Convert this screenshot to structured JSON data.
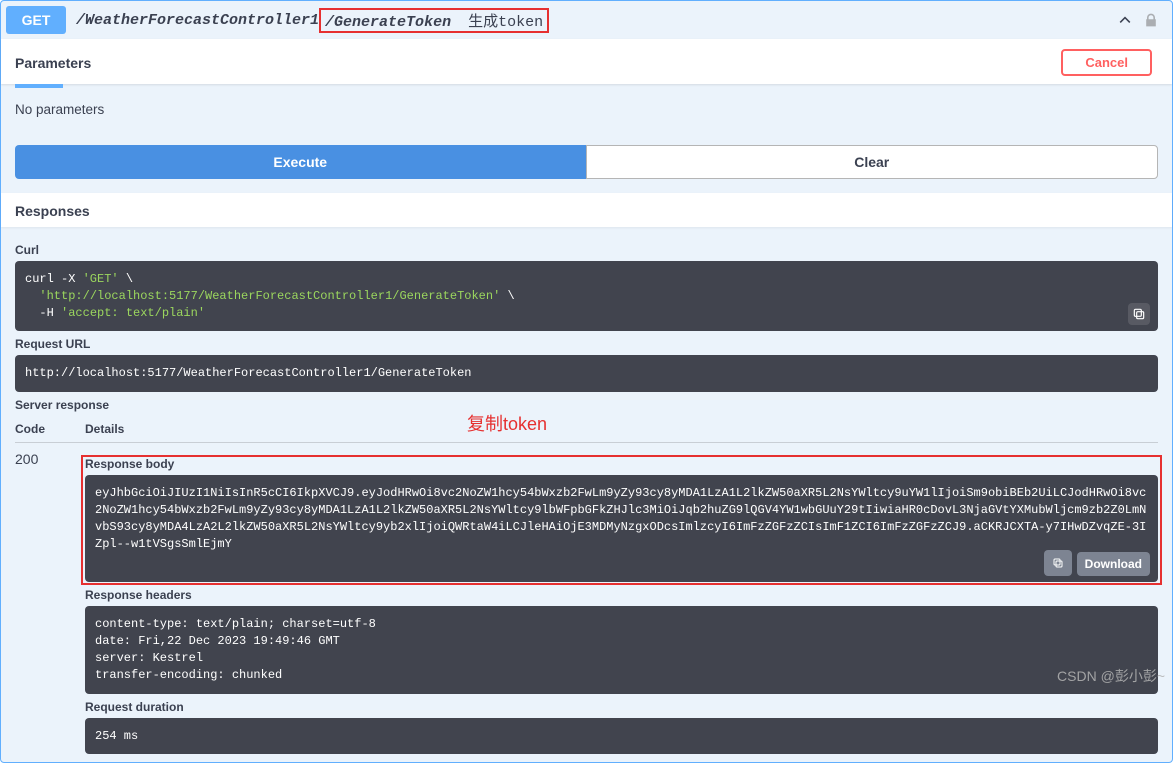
{
  "endpoint": {
    "method": "GET",
    "path_prefix": "/WeatherForecastController1",
    "path_highlight": "/GenerateToken",
    "description": "生成token"
  },
  "parameters": {
    "title": "Parameters",
    "cancel_label": "Cancel",
    "none_text": "No parameters"
  },
  "actions": {
    "execute_label": "Execute",
    "clear_label": "Clear"
  },
  "responses_title": "Responses",
  "curl": {
    "title": "Curl",
    "cmd_prefix": "curl -X ",
    "method": "'GET'",
    "url": "'http://localhost:5177/WeatherForecastController1/GenerateToken'",
    "header_flag": "-H ",
    "header": "'accept: text/plain'"
  },
  "request_url": {
    "title": "Request URL",
    "value": "http://localhost:5177/WeatherForecastController1/GenerateToken"
  },
  "note_copy_token": "复制token",
  "server_response": {
    "title": "Server response",
    "code_header": "Code",
    "details_header": "Details",
    "code": "200",
    "body_title": "Response body",
    "body": "eyJhbGciOiJIUzI1NiIsInR5cCI6IkpXVCJ9.eyJodHRwOi8vc2NoZW1hcy54bWxzb2FwLm9yZy93cy8yMDA1LzA1L2lkZW50aXR5L2NsYWltcy9uYW1lIjoiSm9obiBEb2UiLCJodHRwOi8vc2NoZW1hcy54bWxzb2FwLm9yZy93cy8yMDA1LzA1L2lkZW50aXR5L2NsYWltcy9lbWFpbGFkZHJlc3MiOiJqb2huZG9lQGV4YW1wbGUuY29tIiwiaHR0cDovL3NjaGVtYXMubWljcm9zb2Z0LmNvbS93cy8yMDA4LzA2L2lkZW50aXR5L2NsYWltcy9yb2xlIjoiQWRtaW4iLCJleHAiOjE3MDMyNzgxODcsImlzcyI6ImFzZGFzZCIsImF1ZCI6ImFzZGFzZCJ9.aCKRJCXTA-y7IHwDZvqZE-3IZpl--w1tVSgsSmlEjmY",
    "download_label": "Download",
    "headers_title": "Response headers",
    "headers": {
      "content_type": "content-type: text/plain; charset=utf-8",
      "date": "date: Fri,22 Dec 2023 19:49:46 GMT",
      "server": "server: Kestrel",
      "transfer": "transfer-encoding: chunked"
    },
    "duration_title": "Request duration",
    "duration": "254 ms"
  },
  "watermark": "CSDN @彭小彭~"
}
